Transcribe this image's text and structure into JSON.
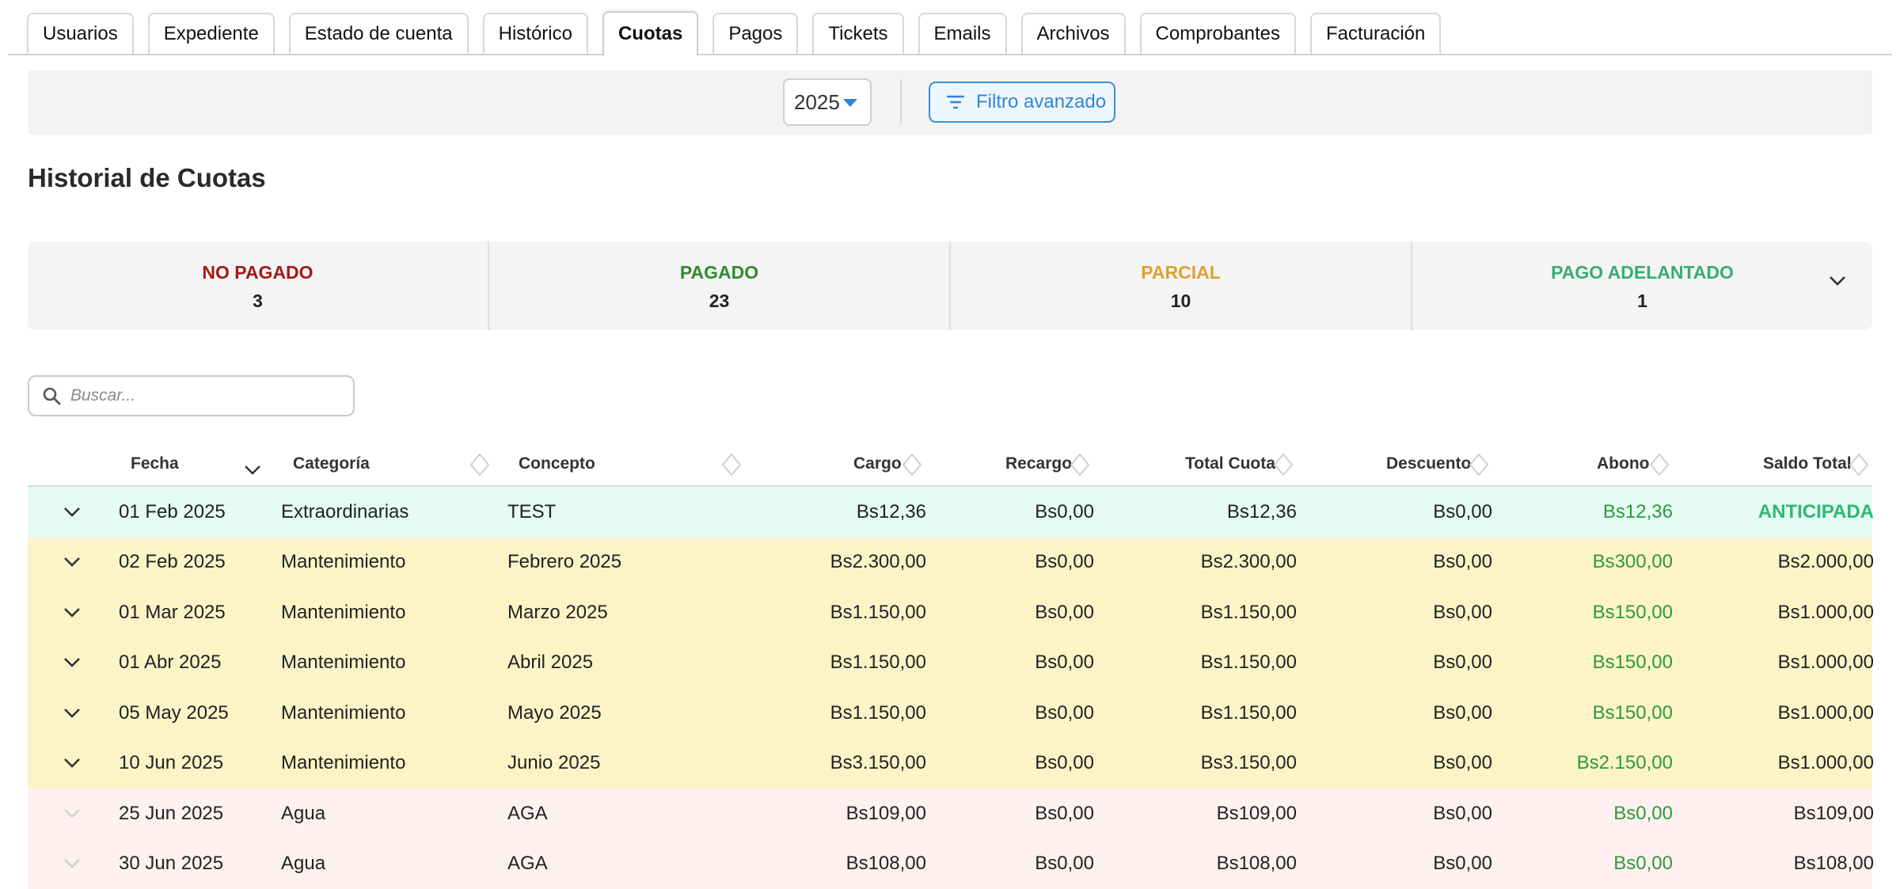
{
  "tabs": [
    "Usuarios",
    "Expediente",
    "Estado de cuenta",
    "Histórico",
    "Cuotas",
    "Pagos",
    "Tickets",
    "Emails",
    "Archivos",
    "Comprobantes",
    "Facturación"
  ],
  "active_tab": "Cuotas",
  "filters": {
    "year": "2025",
    "advanced_label": "Filtro avanzado"
  },
  "title": "Historial de Cuotas",
  "summary": [
    {
      "label": "NO PAGADO",
      "count": "3",
      "color": "#a01a1a"
    },
    {
      "label": "PAGADO",
      "count": "23",
      "color": "#2e8b2e"
    },
    {
      "label": "PARCIAL",
      "count": "10",
      "color": "#e0a030"
    },
    {
      "label": "PAGO ADELANTADO",
      "count": "1",
      "color": "#3aaa7a"
    }
  ],
  "search": {
    "placeholder": "Buscar..."
  },
  "table": {
    "headers": [
      "Fecha",
      "Categoría",
      "Concepto",
      "Cargo",
      "Recargo",
      "Total Cuota",
      "Descuento",
      "Abono",
      "Saldo Total"
    ],
    "rows": [
      {
        "status": "anticipada",
        "fecha": "01 Feb 2025",
        "categoria": "Extraordinarias",
        "concepto": "TEST",
        "cargo": "Bs12,36",
        "recargo": "Bs0,00",
        "total": "Bs12,36",
        "descuento": "Bs0,00",
        "abono": "Bs12,36",
        "saldo": "ANTICIPADA"
      },
      {
        "status": "parcial",
        "fecha": "02 Feb 2025",
        "categoria": "Mantenimiento",
        "concepto": "Febrero 2025",
        "cargo": "Bs2.300,00",
        "recargo": "Bs0,00",
        "total": "Bs2.300,00",
        "descuento": "Bs0,00",
        "abono": "Bs300,00",
        "saldo": "Bs2.000,00"
      },
      {
        "status": "parcial",
        "fecha": "01 Mar 2025",
        "categoria": "Mantenimiento",
        "concepto": "Marzo 2025",
        "cargo": "Bs1.150,00",
        "recargo": "Bs0,00",
        "total": "Bs1.150,00",
        "descuento": "Bs0,00",
        "abono": "Bs150,00",
        "saldo": "Bs1.000,00"
      },
      {
        "status": "parcial",
        "fecha": "01 Abr 2025",
        "categoria": "Mantenimiento",
        "concepto": "Abril 2025",
        "cargo": "Bs1.150,00",
        "recargo": "Bs0,00",
        "total": "Bs1.150,00",
        "descuento": "Bs0,00",
        "abono": "Bs150,00",
        "saldo": "Bs1.000,00"
      },
      {
        "status": "parcial",
        "fecha": "05 May 2025",
        "categoria": "Mantenimiento",
        "concepto": "Mayo 2025",
        "cargo": "Bs1.150,00",
        "recargo": "Bs0,00",
        "total": "Bs1.150,00",
        "descuento": "Bs0,00",
        "abono": "Bs150,00",
        "saldo": "Bs1.000,00"
      },
      {
        "status": "parcial",
        "fecha": "10 Jun 2025",
        "categoria": "Mantenimiento",
        "concepto": "Junio 2025",
        "cargo": "Bs3.150,00",
        "recargo": "Bs0,00",
        "total": "Bs3.150,00",
        "descuento": "Bs0,00",
        "abono": "Bs2.150,00",
        "saldo": "Bs1.000,00"
      },
      {
        "status": "nopagado",
        "fecha": "25 Jun 2025",
        "categoria": "Agua",
        "concepto": "AGA",
        "cargo": "Bs109,00",
        "recargo": "Bs0,00",
        "total": "Bs109,00",
        "descuento": "Bs0,00",
        "abono": "Bs0,00",
        "saldo": "Bs109,00"
      },
      {
        "status": "nopagado",
        "fecha": "30 Jun 2025",
        "categoria": "Agua",
        "concepto": "AGA",
        "cargo": "Bs108,00",
        "recargo": "Bs0,00",
        "total": "Bs108,00",
        "descuento": "Bs0,00",
        "abono": "Bs0,00",
        "saldo": "Bs108,00"
      }
    ]
  }
}
